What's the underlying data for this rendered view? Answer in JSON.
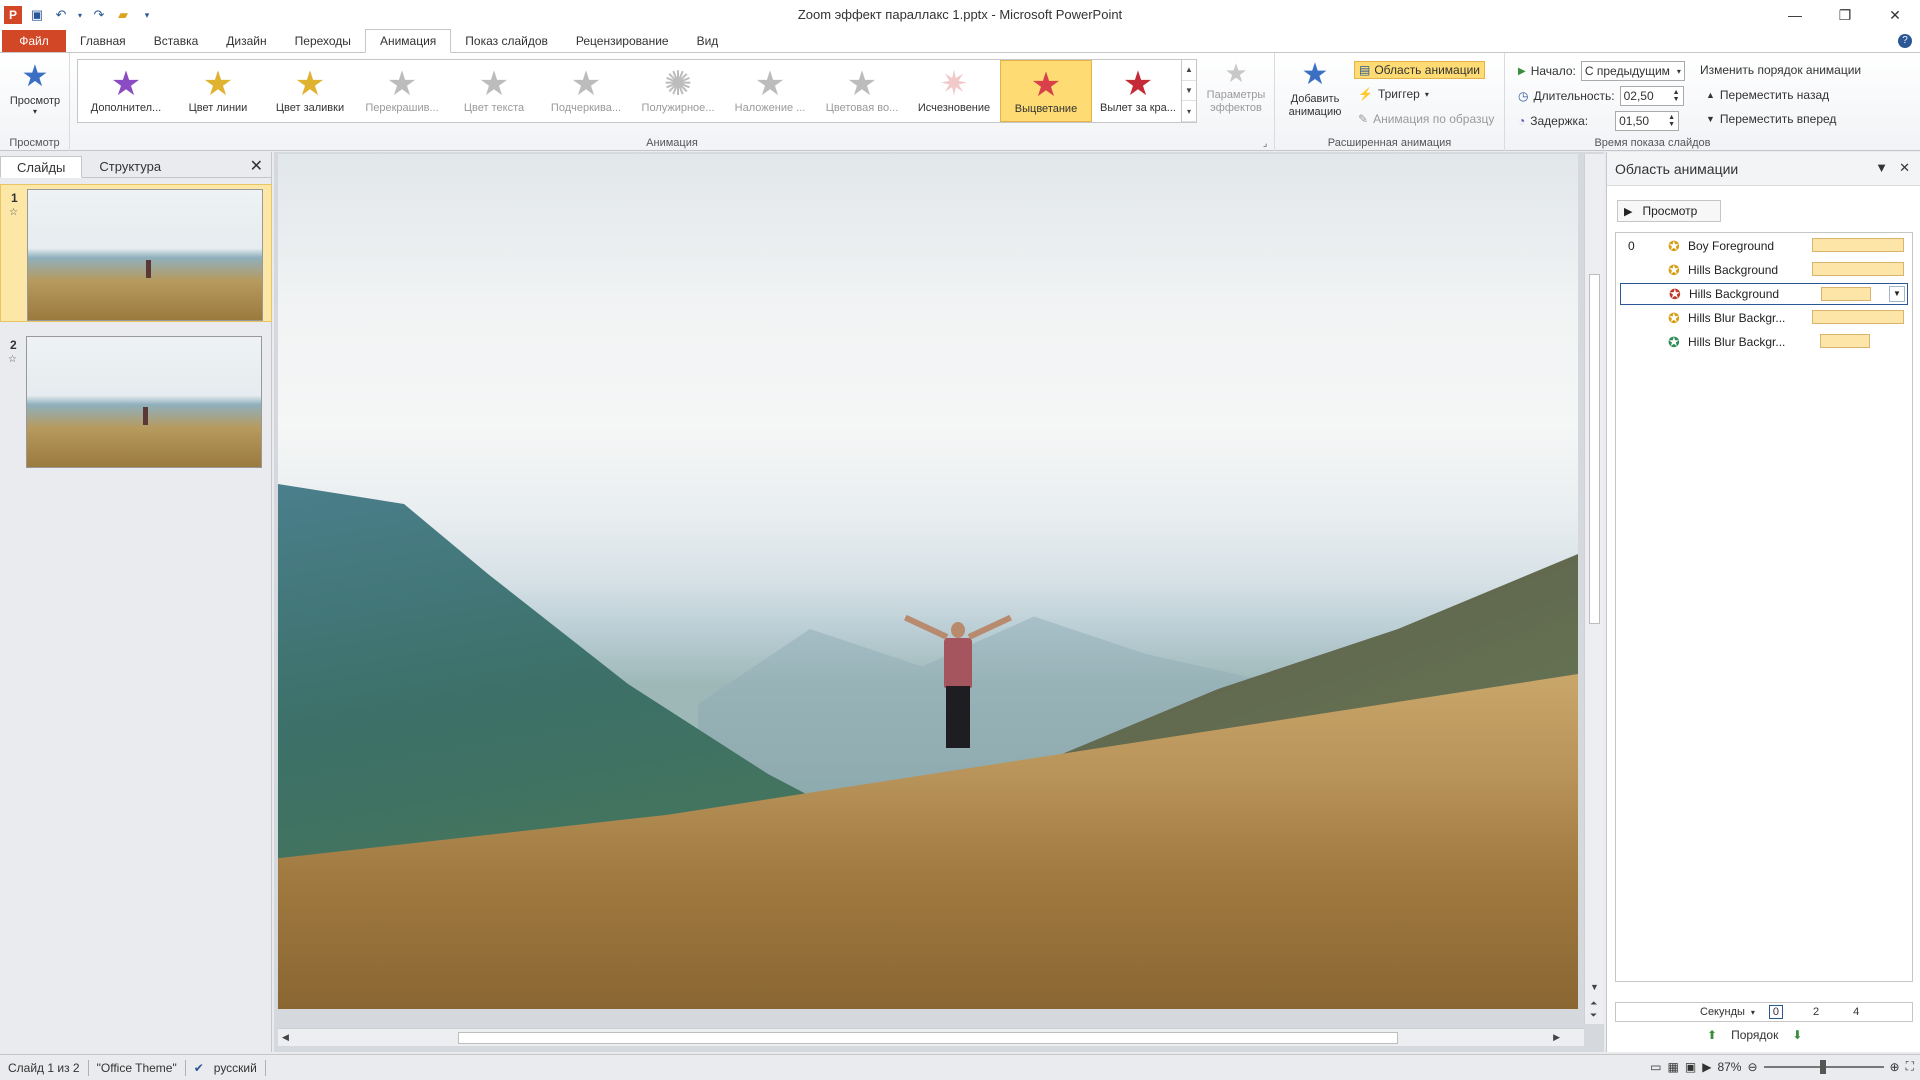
{
  "window": {
    "title": "Zoom эффект параллакс 1.pptx - Microsoft PowerPoint",
    "app_badge": "P",
    "minimize": "—",
    "maximize": "❐",
    "close": "✕"
  },
  "tabs": [
    {
      "label": "Файл"
    },
    {
      "label": "Главная"
    },
    {
      "label": "Вставка"
    },
    {
      "label": "Дизайн"
    },
    {
      "label": "Переходы"
    },
    {
      "label": "Анимация"
    },
    {
      "label": "Показ слайдов"
    },
    {
      "label": "Рецензирование"
    },
    {
      "label": "Вид"
    }
  ],
  "ribbon": {
    "preview": {
      "button": "Просмотр",
      "group": "Просмотр"
    },
    "animation": {
      "group": "Анимация",
      "items": [
        {
          "label": "Дополнител...",
          "color": "#8a4cc2"
        },
        {
          "label": "Цвет линии",
          "color": "#e0b232"
        },
        {
          "label": "Цвет заливки",
          "color": "#e0b232"
        },
        {
          "label": "Перекрашив...",
          "color": "#bcbcbc"
        },
        {
          "label": "Цвет текста",
          "color": "#bcbcbc"
        },
        {
          "label": "Подчеркива...",
          "color": "#bcbcbc"
        },
        {
          "label": "Полужирное...",
          "color": "#bcbcbc"
        },
        {
          "label": "Наложение ...",
          "color": "#bcbcbc"
        },
        {
          "label": "Цветовая во...",
          "color": "#bcbcbc"
        },
        {
          "label": "Исчезновение",
          "color": "#f0c9c9"
        },
        {
          "label": "Выцветание",
          "color": "#d9414a"
        },
        {
          "label": "Вылет за кра...",
          "color": "#c42b36"
        }
      ],
      "effect_options": "Параметры эффектов"
    },
    "advanced": {
      "group": "Расширенная анимация",
      "add_animation": "Добавить анимацию",
      "animation_pane": "Область анимации",
      "trigger": "Триггер",
      "painter": "Анимация по образцу"
    },
    "timing": {
      "group": "Время показа слайдов",
      "start_label": "Начало:",
      "start_value": "С предыдущим",
      "duration_label": "Длительность:",
      "duration_value": "02,50",
      "delay_label": "Задержка:",
      "delay_value": "01,50",
      "reorder": "Изменить порядок анимации",
      "move_back": "Переместить назад",
      "move_forward": "Переместить вперед"
    }
  },
  "slides_pane": {
    "tabs": [
      "Слайды",
      "Структура"
    ],
    "slides": [
      {
        "number": "1"
      },
      {
        "number": "2"
      }
    ]
  },
  "animation_pane": {
    "title": "Область анимации",
    "play": "Просмотр",
    "items": [
      {
        "number": "0",
        "name": "Boy Foreground",
        "icon_color": "#d4a017"
      },
      {
        "number": "",
        "name": "Hills Background",
        "icon_color": "#d4a017"
      },
      {
        "number": "",
        "name": "Hills Background",
        "icon_color": "#c0392b"
      },
      {
        "number": "",
        "name": "Hills Blur Backgr...",
        "icon_color": "#d4a017"
      },
      {
        "number": "",
        "name": "Hills Blur Backgr...",
        "icon_color": "#2e8b57"
      }
    ],
    "timeline": {
      "unit": "Секунды",
      "ticks": [
        "0",
        "2",
        "4"
      ]
    },
    "order": "Порядок"
  },
  "status": {
    "slide": "Слайд 1 из 2",
    "theme": "\"Office Theme\"",
    "language": "русский",
    "zoom": "87%"
  }
}
